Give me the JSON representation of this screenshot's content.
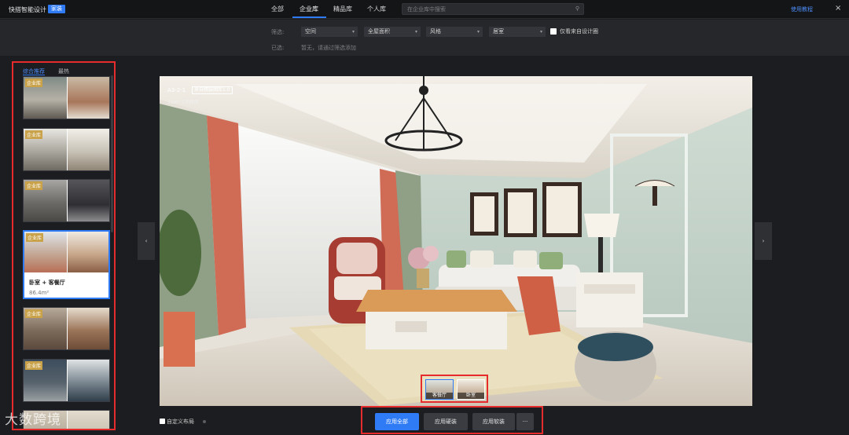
{
  "app": {
    "name": "快搭智能设计",
    "badge": "家装"
  },
  "nav": {
    "tabs": [
      "全部",
      "企业库",
      "精品库",
      "个人库"
    ],
    "active": "企业库"
  },
  "search": {
    "placeholder": "在企业库中搜索"
  },
  "header": {
    "help": "使用教程"
  },
  "filters": {
    "label": "筛选:",
    "selects": [
      "空间",
      "全屋面积",
      "风格",
      "居室"
    ],
    "checkbox_label": "仅看来自设计圈",
    "selected_label": "已选:",
    "selected_hint": "暂无，请通过筛选添加"
  },
  "left_panel": {
    "tabs": [
      "综合推荐",
      "最热"
    ],
    "card_tag": "企业库",
    "selected_card": {
      "name": "卧室 + 客餐厅",
      "area": "86.4m²"
    }
  },
  "viewer": {
    "plan_name": "A3-2-1",
    "plan_tag": "来自精装图库1.0",
    "plan_meta": "31m²  1次使用",
    "rooms": [
      "客餐厅",
      "卧室"
    ]
  },
  "bottom": {
    "custom_layout": "自定义布局",
    "buttons": [
      "应用全部",
      "应用硬装",
      "应用软装"
    ],
    "more": "···"
  },
  "watermark": "大数跨境",
  "colors": {
    "accent": "#2f7bf6",
    "highlight_border": "#e52b2b",
    "tag_gold": "#c9a24a"
  }
}
